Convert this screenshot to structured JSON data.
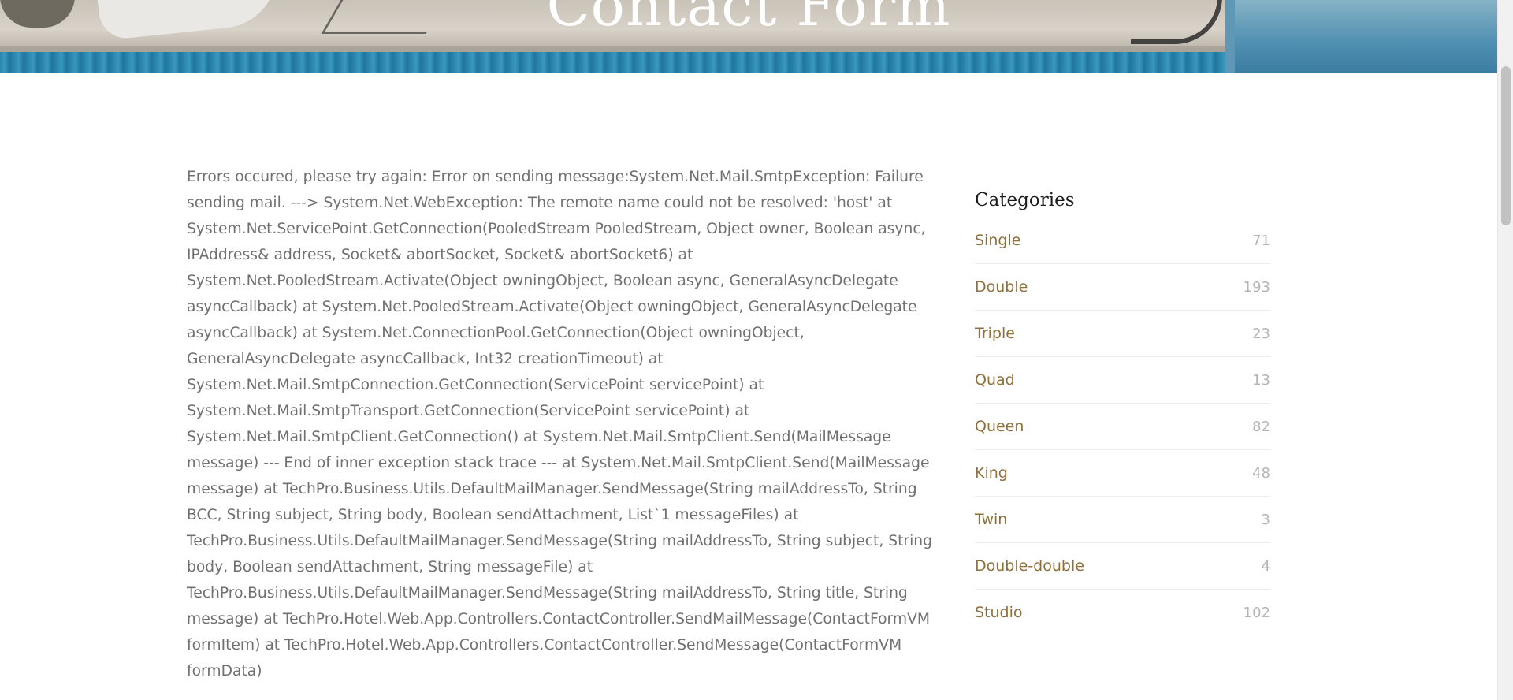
{
  "hero": {
    "title": "Contact Form"
  },
  "error": {
    "message": "Errors occured, please try again: Error on sending message:System.Net.Mail.SmtpException: Failure sending mail. ---> System.Net.WebException: The remote name could not be resolved: 'host' at System.Net.ServicePoint.GetConnection(PooledStream PooledStream, Object owner, Boolean async, IPAddress& address, Socket& abortSocket, Socket& abortSocket6) at System.Net.PooledStream.Activate(Object owningObject, Boolean async, GeneralAsyncDelegate asyncCallback) at System.Net.PooledStream.Activate(Object owningObject, GeneralAsyncDelegate asyncCallback) at System.Net.ConnectionPool.GetConnection(Object owningObject, GeneralAsyncDelegate asyncCallback, Int32 creationTimeout) at System.Net.Mail.SmtpConnection.GetConnection(ServicePoint servicePoint) at System.Net.Mail.SmtpTransport.GetConnection(ServicePoint servicePoint) at System.Net.Mail.SmtpClient.GetConnection() at System.Net.Mail.SmtpClient.Send(MailMessage message) --- End of inner exception stack trace --- at System.Net.Mail.SmtpClient.Send(MailMessage message) at TechPro.Business.Utils.DefaultMailManager.SendMessage(String mailAddressTo, String BCC, String subject, String body, Boolean sendAttachment, List`1 messageFiles) at TechPro.Business.Utils.DefaultMailManager.SendMessage(String mailAddressTo, String subject, String body, Boolean sendAttachment, String messageFile) at TechPro.Business.Utils.DefaultMailManager.SendMessage(String mailAddressTo, String title, String message) at TechPro.Hotel.Web.App.Controllers.ContactController.SendMailMessage(ContactFormVM formItem) at TechPro.Hotel.Web.App.Controllers.ContactController.SendMessage(ContactFormVM formData)"
  },
  "sidebar": {
    "title": "Categories",
    "categories": [
      {
        "name": "Single",
        "count": "71"
      },
      {
        "name": "Double",
        "count": "193"
      },
      {
        "name": "Triple",
        "count": "23"
      },
      {
        "name": "Quad",
        "count": "13"
      },
      {
        "name": "Queen",
        "count": "82"
      },
      {
        "name": "King",
        "count": "48"
      },
      {
        "name": "Twin",
        "count": "3"
      },
      {
        "name": "Double-double",
        "count": "4"
      },
      {
        "name": "Studio",
        "count": "102"
      }
    ]
  },
  "colors": {
    "link": "#8f6f3a",
    "count": "#b5b5b5",
    "body_text": "#707070"
  }
}
